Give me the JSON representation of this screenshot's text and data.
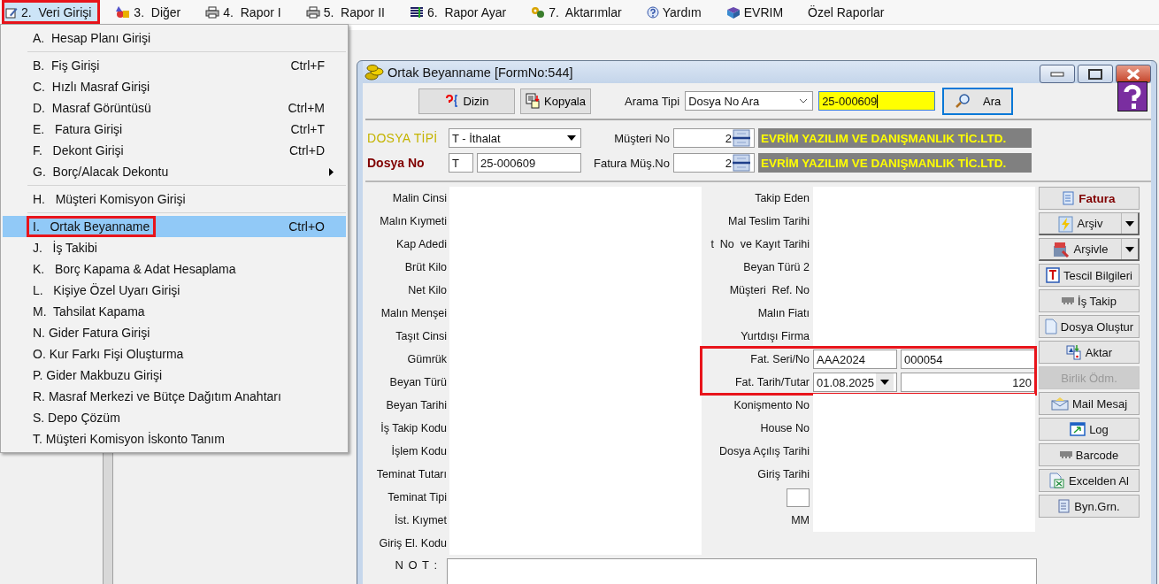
{
  "menubar": [
    {
      "label": "2.  Veri Girişi",
      "selected": true,
      "outlined": true
    },
    {
      "label": "3.  Diğer",
      "selected": false,
      "outlined": false
    },
    {
      "label": "4.  Rapor I",
      "selected": false,
      "outlined": false
    },
    {
      "label": "5.  Rapor II",
      "selected": false,
      "outlined": false
    },
    {
      "label": "6.  Rapor Ayar",
      "selected": false,
      "outlined": false
    },
    {
      "label": "7.  Aktarımlar",
      "selected": false,
      "outlined": false
    },
    {
      "label": "Yardım",
      "selected": false,
      "outlined": false
    },
    {
      "label": "EVRIM",
      "selected": false,
      "outlined": false
    },
    {
      "label": "Özel Raporlar",
      "selected": false,
      "outlined": false
    }
  ],
  "menu": {
    "groups": [
      [
        {
          "label": "A.  Hesap Planı Girişi",
          "selected": false,
          "outlined": false,
          "submenu": false
        }
      ],
      [
        {
          "label": "B.  Fiş Girişi",
          "shortcut": "Ctrl+F",
          "selected": false,
          "outlined": false,
          "submenu": false
        },
        {
          "label": "C.  Hızlı Masraf Girişi",
          "selected": false,
          "outlined": false,
          "submenu": false
        },
        {
          "label": "D.  Masraf Görüntüsü",
          "shortcut": "Ctrl+M",
          "selected": false,
          "outlined": false,
          "submenu": false
        },
        {
          "label": "E.   Fatura Girişi",
          "shortcut": "Ctrl+T",
          "selected": false,
          "outlined": false,
          "submenu": false
        },
        {
          "label": "F.   Dekont Girişi",
          "shortcut": "Ctrl+D",
          "selected": false,
          "outlined": false,
          "submenu": false
        },
        {
          "label": "G.  Borç/Alacak Dekontu",
          "selected": false,
          "outlined": false,
          "submenu": true
        }
      ],
      [
        {
          "label": "H.   Müşteri Komisyon Girişi",
          "selected": false,
          "outlined": false,
          "submenu": false
        }
      ],
      [
        {
          "label": "I.   Ortak Beyanname",
          "shortcut": "Ctrl+O",
          "selected": true,
          "outlined": true,
          "submenu": false
        },
        {
          "label": "J.   İş Takibi",
          "selected": false,
          "outlined": false,
          "submenu": false
        },
        {
          "label": "K.   Borç Kapama & Adat Hesaplama",
          "selected": false,
          "outlined": false,
          "submenu": false
        },
        {
          "label": "L.   Kişiye Özel Uyarı Girişi",
          "selected": false,
          "outlined": false,
          "submenu": false
        },
        {
          "label": "M.  Tahsilat Kapama",
          "selected": false,
          "outlined": false,
          "submenu": false
        },
        {
          "label": "N. Gider Fatura Girişi",
          "selected": false,
          "outlined": false,
          "submenu": false
        },
        {
          "label": "O. Kur Farkı Fişi Oluşturma",
          "selected": false,
          "outlined": false,
          "submenu": false
        },
        {
          "label": "P. Gider Makbuzu Girişi",
          "selected": false,
          "outlined": false,
          "submenu": false
        },
        {
          "label": "R. Masraf Merkezi ve Bütçe Dağıtım Anahtarı",
          "selected": false,
          "outlined": false,
          "submenu": false
        },
        {
          "label": "S. Depo Çözüm",
          "selected": false,
          "outlined": false,
          "submenu": false
        },
        {
          "label": "T. Müşteri Komisyon İskonto Tanım",
          "selected": false,
          "outlined": false,
          "submenu": false
        }
      ]
    ]
  },
  "window": {
    "title": "Ortak Beyanname [FormNo:544]"
  },
  "toolbar": {
    "buttons": [
      {
        "label": "Dizin"
      },
      {
        "label": "Kopyala"
      }
    ],
    "search_type_label": "Arama Tipi",
    "search_type": "Dosya No Ara",
    "search_value": "25-000609",
    "search_button": "Ara"
  },
  "header": {
    "file_type_label": "DOSYA TİPİ",
    "file_type": "T - İthalat",
    "file_no_label": "Dosya No",
    "file_no_prefix": "T",
    "file_no": "25-000609",
    "customer_no_label": "Müşteri No",
    "customer_no": "2",
    "customer_name": "EVRİM YAZILIM VE DANIŞMANLIK TİC.LTD.",
    "invoice_customer_label": "Fatura Müş.No",
    "invoice_customer_no": "2",
    "invoice_customer_name": "EVRİM YAZILIM VE DANIŞMANLIK TİC.LTD."
  },
  "left_fields": [
    "Malin Cinsi",
    "Malın Kıymeti",
    "Kap Adedi",
    "Brüt Kilo",
    "Net Kilo",
    "Malın Menşei",
    "Taşıt Cinsi",
    "Gümrük",
    "Beyan Türü",
    "Beyan Tarihi",
    "İş Takip Kodu",
    "İşlem Kodu",
    "Teminat Tutarı",
    "Teminat Tipi",
    "İst. Kıymet",
    "Giriş El. Kodu"
  ],
  "right_fields": [
    {
      "kind": "text",
      "label": "Takip Eden",
      "highlighted": false
    },
    {
      "kind": "text",
      "label": "Mal Teslim Tarihi",
      "highlighted": false
    },
    {
      "kind": "text",
      "label": "t  No  ve Kayıt Tarihi",
      "highlighted": false
    },
    {
      "kind": "text",
      "label": "Beyan Türü 2",
      "highlighted": false
    },
    {
      "kind": "text",
      "label": "Müşteri  Ref. No",
      "highlighted": false
    },
    {
      "kind": "text",
      "label": "Malın Fiatı",
      "highlighted": false
    },
    {
      "kind": "text",
      "label": "Yurtdışı Firma",
      "highlighted": false
    },
    {
      "kind": "pair",
      "label": "Fat. Seri/No",
      "value": "AAA2024",
      "value_2": "000054",
      "highlighted": true
    },
    {
      "kind": "date_amount",
      "label": "Fat. Tarih/Tutar",
      "value": "01.08.2025",
      "value_2": "120",
      "highlighted": true
    },
    {
      "kind": "text",
      "label": "Konişmento No",
      "highlighted": false
    },
    {
      "kind": "text",
      "label": "House No",
      "highlighted": false
    },
    {
      "kind": "text",
      "label": "Dosya Açılış Tarihi",
      "highlighted": false
    },
    {
      "kind": "text",
      "label": "Giriş Tarihi",
      "highlighted": false
    },
    {
      "kind": "box",
      "highlighted": false
    },
    {
      "kind": "text",
      "label": "MM",
      "highlighted": false
    }
  ],
  "side_buttons": [
    {
      "label": "Fatura",
      "kind": "primary",
      "disabled": false
    },
    {
      "label": "Arşiv",
      "kind": "split",
      "disabled": false
    },
    {
      "label": "Arşivle",
      "kind": "split",
      "disabled": false
    },
    {
      "label": "Tescil Bilgileri",
      "kind": "plain",
      "disabled": false
    },
    {
      "label": "İş Takip",
      "kind": "plain",
      "disabled": false
    },
    {
      "label": "Dosya Oluştur",
      "kind": "plain",
      "disabled": false
    },
    {
      "label": "Aktar",
      "kind": "plain",
      "disabled": false
    },
    {
      "label": "Birlik Ödm.",
      "kind": "plain",
      "disabled": true
    },
    {
      "label": "Mail Mesaj",
      "kind": "plain",
      "disabled": false
    },
    {
      "label": "Log",
      "kind": "plain",
      "disabled": false
    },
    {
      "label": "Barcode",
      "kind": "plain",
      "disabled": false
    },
    {
      "label": "Excelden Al",
      "kind": "plain",
      "disabled": false
    },
    {
      "label": "Byn.Grn.",
      "kind": "plain",
      "disabled": false
    }
  ],
  "note_label": "N O T :"
}
